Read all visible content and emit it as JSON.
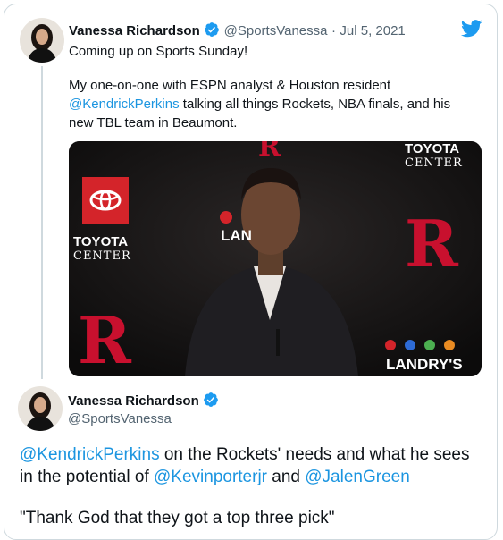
{
  "tweet": {
    "display_name": "Vanessa Richardson",
    "handle": "@SportsVanessa",
    "separator": "·",
    "date": "Jul 5, 2021",
    "line1": "Coming up on Sports Sunday!",
    "body_line1": "My one-on-one with ESPN analyst & Houston resident",
    "mention_perkins": "@KendrickPerkins",
    "body_line2_rest": " talking all things Rockets, NBA finals, and his",
    "body_line3": "new TBL team in Beaumont."
  },
  "media": {
    "backdrop_brand": "TOYOTA",
    "backdrop_brand_sub": "CENTER",
    "backdrop_right_brand": "TOYOTA",
    "backdrop_right_sub": "CENTER",
    "landrys_label": "LANDRY'S",
    "lan_label": "LAN"
  },
  "quote": {
    "display_name": "Vanessa Richardson",
    "handle": "@SportsVanessa",
    "mention_perkins": "@KendrickPerkins",
    "line1_rest": " on the Rockets' needs and what he sees",
    "line2_start": "in the potential of ",
    "mention_porter": "@Kevinporterjr",
    "line2_and": " and ",
    "mention_green": "@JalenGreen",
    "quote_line": "\"Thank God that they got a top three pick\""
  },
  "colors": {
    "link": "#1b95e0",
    "twitter_blue": "#1d9bf0",
    "rockets_red": "#ce1141"
  },
  "icons": {
    "verified": "verified-badge-icon",
    "twitter": "twitter-bird-icon"
  }
}
